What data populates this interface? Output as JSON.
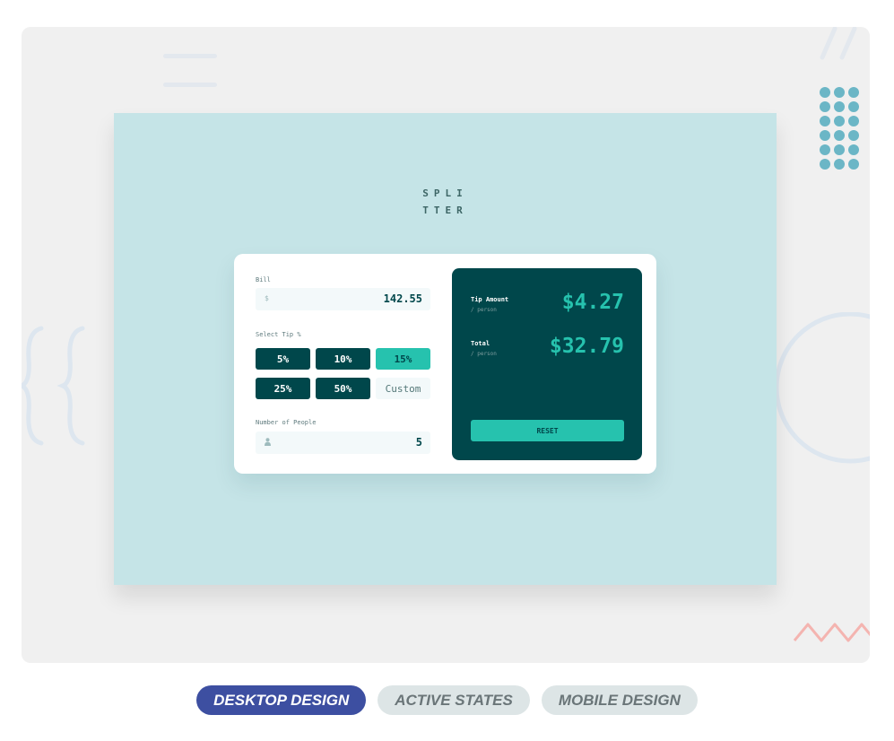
{
  "app": {
    "logo_line1": "SPLI",
    "logo_line2": "TTER"
  },
  "bill": {
    "label": "Bill",
    "icon": "dollar-icon",
    "icon_glyph": "$",
    "value": "142.55"
  },
  "tip": {
    "label": "Select Tip %",
    "options": [
      "5%",
      "10%",
      "15%",
      "25%",
      "50%"
    ],
    "selected": "15%",
    "custom_placeholder": "Custom"
  },
  "people": {
    "label": "Number of People",
    "icon": "person-icon",
    "value": "5"
  },
  "results": {
    "tip_amount_label": "Tip Amount",
    "tip_amount_sub": "/ person",
    "tip_amount_value": "$4.27",
    "total_label": "Total",
    "total_sub": "/ person",
    "total_value": "$32.79",
    "reset_label": "RESET"
  },
  "tabs": [
    {
      "label": "DESKTOP DESIGN",
      "active": true
    },
    {
      "label": "ACTIVE STATES",
      "active": false
    },
    {
      "label": "MOBILE DESIGN",
      "active": false
    }
  ],
  "colors": {
    "dark_cyan": "#00474b",
    "strong_cyan": "#26c2ae",
    "canvas_bg": "#c5e4e7",
    "tab_active": "#3d4fa1",
    "tab_inactive": "#dde5e6"
  }
}
